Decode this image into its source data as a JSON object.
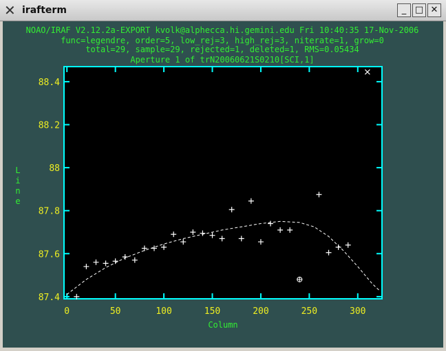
{
  "window": {
    "title": "irafterm",
    "icon": "x-logo-icon",
    "controls": {
      "minimize": "_",
      "maximize": "□",
      "close": "✕"
    }
  },
  "header": {
    "line1": "NOAO/IRAF V2.12.2a-EXPORT kvolk@alphecca.hi.gemini.edu Fri 10:40:35 17-Nov-2006",
    "line2": "func=legendre, order=5, low_rej=3, high_rej=3, niterate=1, grow=0",
    "line3": "total=29, sample=29, rejected=1, deleted=1, RMS=0.05434",
    "line4": "Aperture 1 of trN20060621S0210[SCI,1]"
  },
  "colors": {
    "background": "#2f4f4f",
    "plot_bg": "#000000",
    "frame": "#00ffff",
    "header_text": "#33ee33",
    "tick_text": "#eeee22",
    "points": "#ffffff"
  },
  "chart_data": {
    "type": "scatter",
    "xlabel": "Column",
    "ylabel": "Line",
    "xlim": [
      -3,
      325
    ],
    "ylim": [
      87.39,
      88.47
    ],
    "x_ticks": [
      "0",
      "50",
      "100",
      "150",
      "200",
      "250",
      "300"
    ],
    "y_ticks": [
      "87.4",
      "87.6",
      "87.8",
      "88",
      "88.2",
      "88.4"
    ],
    "points": [
      {
        "x": 10,
        "y": 87.4
      },
      {
        "x": 20,
        "y": 87.54
      },
      {
        "x": 30,
        "y": 87.56
      },
      {
        "x": 40,
        "y": 87.555
      },
      {
        "x": 50,
        "y": 87.565
      },
      {
        "x": 60,
        "y": 87.585
      },
      {
        "x": 70,
        "y": 87.57
      },
      {
        "x": 80,
        "y": 87.625
      },
      {
        "x": 90,
        "y": 87.625
      },
      {
        "x": 100,
        "y": 87.63
      },
      {
        "x": 110,
        "y": 87.69
      },
      {
        "x": 120,
        "y": 87.655
      },
      {
        "x": 130,
        "y": 87.7
      },
      {
        "x": 140,
        "y": 87.695
      },
      {
        "x": 150,
        "y": 87.685
      },
      {
        "x": 160,
        "y": 87.67
      },
      {
        "x": 170,
        "y": 87.805
      },
      {
        "x": 180,
        "y": 87.67
      },
      {
        "x": 190,
        "y": 87.845
      },
      {
        "x": 200,
        "y": 87.655
      },
      {
        "x": 210,
        "y": 87.74
      },
      {
        "x": 220,
        "y": 87.71
      },
      {
        "x": 230,
        "y": 87.71
      },
      {
        "x": 260,
        "y": 87.875
      },
      {
        "x": 270,
        "y": 87.605
      },
      {
        "x": 280,
        "y": 87.63
      },
      {
        "x": 290,
        "y": 87.64
      }
    ],
    "rejected_points": [
      {
        "x": 240,
        "y": 87.48
      }
    ],
    "deleted_points": [
      {
        "x": 310,
        "y": 88.445
      }
    ],
    "fit_curve": [
      {
        "x": 0,
        "y": 87.41
      },
      {
        "x": 20,
        "y": 87.48
      },
      {
        "x": 40,
        "y": 87.535
      },
      {
        "x": 60,
        "y": 87.58
      },
      {
        "x": 80,
        "y": 87.615
      },
      {
        "x": 100,
        "y": 87.645
      },
      {
        "x": 120,
        "y": 87.67
      },
      {
        "x": 140,
        "y": 87.69
      },
      {
        "x": 160,
        "y": 87.71
      },
      {
        "x": 180,
        "y": 87.725
      },
      {
        "x": 200,
        "y": 87.74
      },
      {
        "x": 220,
        "y": 87.75
      },
      {
        "x": 240,
        "y": 87.745
      },
      {
        "x": 255,
        "y": 87.725
      },
      {
        "x": 270,
        "y": 87.68
      },
      {
        "x": 285,
        "y": 87.615
      },
      {
        "x": 300,
        "y": 87.54
      },
      {
        "x": 315,
        "y": 87.46
      },
      {
        "x": 322,
        "y": 87.43
      }
    ]
  }
}
